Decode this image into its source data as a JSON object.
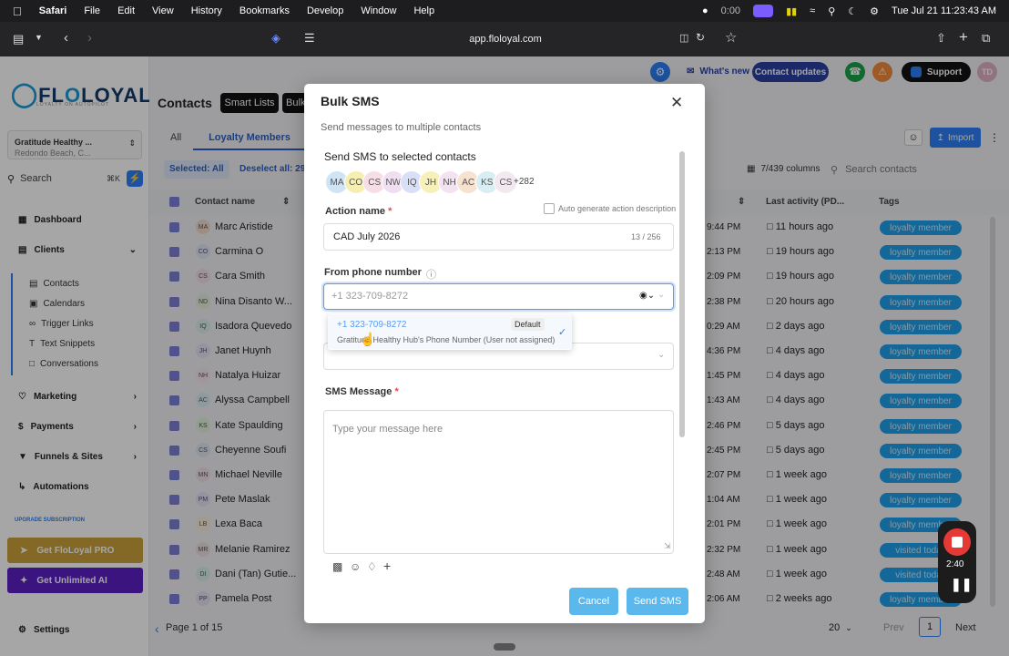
{
  "menubar": {
    "apple": "",
    "app": "Safari",
    "items": [
      "File",
      "Edit",
      "View",
      "History",
      "Bookmarks",
      "Develop",
      "Window",
      "Help"
    ],
    "time_small": "0:00",
    "datetime": "Tue Jul 21  11:23:43 AM"
  },
  "browser": {
    "url": "app.floloyal.com"
  },
  "sidebar": {
    "logo_part1": "FL",
    "logo_o": "O",
    "logo_part2": "LOYAL",
    "logo_tagline": "LOYALTY ON AUTOPILOT",
    "location_name": "Gratitude Healthy ...",
    "location_sub": "Redondo Beach, C...",
    "search": "Search",
    "search_shortcut": "⌘K",
    "nav": [
      {
        "label": "Dashboard"
      },
      {
        "label": "Clients"
      },
      {
        "label": "Marketing"
      },
      {
        "label": "Payments"
      },
      {
        "label": "Funnels & Sites"
      },
      {
        "label": "Automations"
      }
    ],
    "sub": [
      "Contacts",
      "Calendars",
      "Trigger Links",
      "Text Snippets",
      "Conversations"
    ],
    "upgrade": "UPGRADE SUBSCRIPTION",
    "pro": "Get FloLoyal PRO",
    "ai": "Get Unlimited AI",
    "settings": "Settings"
  },
  "header": {
    "whats_new": "What's new",
    "contact_updates": "Contact updates",
    "support": "Support",
    "avatar": "TD",
    "contacts": "Contacts",
    "smart_lists": "Smart Lists",
    "bulk": "Bulk"
  },
  "tabs": {
    "all": "All",
    "loyalty": "Loyalty Members"
  },
  "selection": {
    "selected": "Selected: All",
    "deselect": "Deselect all: 29"
  },
  "table": {
    "import": "Import",
    "columns": "7/439 columns",
    "search_placeholder": "Search contacts",
    "col_name": "Contact name",
    "col_activity": "Last activity (PD...",
    "col_tags": "Tags",
    "rows": [
      {
        "i": "MA",
        "name": "Marc Aristide",
        "time": "9:44 PM",
        "last": "11 hours ago",
        "tag": "loyalty member",
        "c": "#f3d9c9"
      },
      {
        "i": "CO",
        "name": "Carmina O",
        "time": "2:13 PM",
        "last": "19 hours ago",
        "tag": "loyalty member",
        "c": "#dfe3f7"
      },
      {
        "i": "CS",
        "name": "Cara Smith",
        "time": "2:09 PM",
        "last": "19 hours ago",
        "tag": "loyalty member",
        "c": "#f7dfe6"
      },
      {
        "i": "ND",
        "name": "Nina Disanto W...",
        "time": "2:38 PM",
        "last": "20 hours ago",
        "tag": "loyalty member",
        "c": "#e2f0d9"
      },
      {
        "i": "IQ",
        "name": "Isadora Quevedo",
        "time": "0:29 AM",
        "last": "2 days ago",
        "tag": "loyalty member",
        "c": "#d9f0e6"
      },
      {
        "i": "JH",
        "name": "Janet Huynh",
        "time": "4:36 PM",
        "last": "4 days ago",
        "tag": "loyalty member",
        "c": "#e6e0f7"
      },
      {
        "i": "NH",
        "name": "Natalya Huizar",
        "time": "1:45 PM",
        "last": "4 days ago",
        "tag": "loyalty member",
        "c": "#f7e6f0"
      },
      {
        "i": "AC",
        "name": "Alyssa Campbell",
        "time": "1:43 AM",
        "last": "4 days ago",
        "tag": "loyalty member",
        "c": "#d9eef7"
      },
      {
        "i": "KS",
        "name": "Kate Spaulding",
        "time": "2:46 PM",
        "last": "5 days ago",
        "tag": "loyalty member",
        "c": "#dff2d9"
      },
      {
        "i": "CS",
        "name": "Cheyenne Soufi",
        "time": "2:45 PM",
        "last": "5 days ago",
        "tag": "loyalty member",
        "c": "#dfe6f2"
      },
      {
        "i": "MN",
        "name": "Michael Neville",
        "time": "2:07 PM",
        "last": "1 week ago",
        "tag": "loyalty member",
        "c": "#f2dfe9"
      },
      {
        "i": "PM",
        "name": "Pete Maslak",
        "time": "1:04 AM",
        "last": "1 week ago",
        "tag": "loyalty member",
        "c": "#e9e0f7"
      },
      {
        "i": "LB",
        "name": "Lexa Baca",
        "time": "2:01 PM",
        "last": "1 week ago",
        "tag": "loyalty member",
        "c": "#f7efd9"
      },
      {
        "i": "MR",
        "name": "Melanie Ramirez",
        "time": "2:32 PM",
        "last": "1 week ago",
        "tag": "visited today",
        "c": "#f0dfdf"
      },
      {
        "i": "DI",
        "name": "Dani (Tan) Gutie...",
        "time": "2:48 AM",
        "last": "1 week ago",
        "tag": "visited today",
        "c": "#d9efe6"
      },
      {
        "i": "PP",
        "name": "Pamela Post",
        "time": "2:06 AM",
        "last": "2 weeks ago",
        "tag": "loyalty member",
        "c": "#e6dff2"
      }
    ],
    "pagination": "Page 1 of 15",
    "per_page": "20",
    "prev": "Prev",
    "page": "1",
    "next": "Next"
  },
  "modal": {
    "title": "Bulk SMS",
    "subtitle": "Send messages to multiple contacts",
    "section": "Send SMS to selected contacts",
    "chips": [
      {
        "i": "MA",
        "c": "#cfe4f5"
      },
      {
        "i": "CO",
        "c": "#f7efb0"
      },
      {
        "i": "CS",
        "c": "#f7dde6"
      },
      {
        "i": "NW",
        "c": "#efdff0"
      },
      {
        "i": "IQ",
        "c": "#d9dff7"
      },
      {
        "i": "JH",
        "c": "#f7f0b8"
      },
      {
        "i": "NH",
        "c": "#f3e2ef"
      },
      {
        "i": "AC",
        "c": "#f7e2cf"
      },
      {
        "i": "KS",
        "c": "#d9eef2"
      },
      {
        "i": "CS",
        "c": "#f2e8ef"
      }
    ],
    "more": "+282",
    "action_label": "Action name",
    "auto_generate": "Auto generate action description",
    "action_value": "CAD July 2026",
    "action_count": "13 / 256",
    "from_label": "From phone number",
    "from_placeholder": "+1 323-709-8272",
    "option_phone": "+1 323-709-8272",
    "option_default": "Default",
    "option_desc": "Gratitude Healthy Hub's Phone Number (User not assigned)",
    "sms_label": "SMS Message",
    "sms_placeholder": "Type your message here",
    "cancel": "Cancel",
    "send": "Send SMS"
  },
  "recorder": {
    "time": "2:40"
  }
}
